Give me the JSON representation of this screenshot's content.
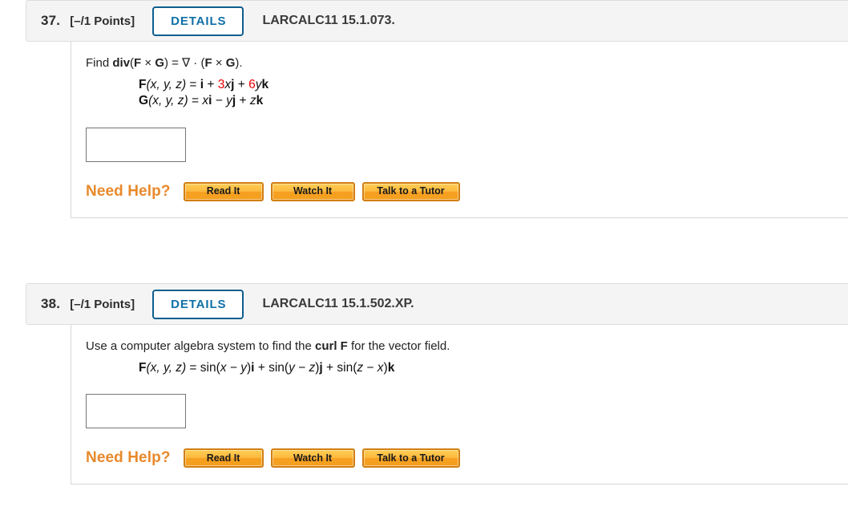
{
  "problems": [
    {
      "number": "37.",
      "points": "[–/1 Points]",
      "details_label": "DETAILS",
      "code": "LARCALC11 15.1.073.",
      "prompt_plain": "Find div(F × G) = ∇ · (F × G).",
      "prompt_parts": {
        "lead": "Find ",
        "div": "div",
        "open": "(",
        "F1": "F",
        "times1": " × ",
        "G1": "G",
        "close_eq": ") = ",
        "nabla": "∇",
        "dot": " · (",
        "F2": "F",
        "times2": " × ",
        "G2": "G",
        "tail": ")."
      },
      "formulas": [
        {
          "fn": "F",
          "args": "(x, y, z)",
          "eq": " = ",
          "terms": "i + 3xj + 6yk",
          "plain": "F(x, y, z) = i + 3xj + 6yk",
          "coef1": "3",
          "coef2": "6"
        },
        {
          "fn": "G",
          "args": "(x, y, z)",
          "eq": " = ",
          "terms": "xi − yj + zk",
          "plain": "G(x, y, z) = xi − yj + zk"
        }
      ],
      "answer_value": "",
      "answer_placeholder": "",
      "help": {
        "label": "Need Help?",
        "buttons": [
          "Read It",
          "Watch It",
          "Talk to a Tutor"
        ]
      }
    },
    {
      "number": "38.",
      "points": "[–/1 Points]",
      "details_label": "DETAILS",
      "code": "LARCALC11 15.1.502.XP.",
      "prompt_plain": "Use a computer algebra system to find the curl F for the vector field.",
      "prompt_parts": {
        "lead": "Use a computer algebra system to find the ",
        "bold": "curl F",
        "tail": " for the vector field."
      },
      "formulas": [
        {
          "fn": "F",
          "args": "(x, y, z)",
          "eq": " = ",
          "terms": "sin(x − y)i + sin(y − z)j + sin(z − x)k",
          "plain": "F(x, y, z) = sin(x − y)i + sin(y − z)j + sin(z − x)k"
        }
      ],
      "answer_value": "",
      "answer_placeholder": "",
      "help": {
        "label": "Need Help?",
        "buttons": [
          "Read It",
          "Watch It",
          "Talk to a Tutor"
        ]
      }
    }
  ],
  "colors": {
    "details_blue": "#0f5e8f",
    "details_text": "#1070a8",
    "help_orange": "#e8892b",
    "accent_red": "#ee0000",
    "header_bg": "#f4f4f4",
    "border_gray": "#d6d6d6"
  }
}
